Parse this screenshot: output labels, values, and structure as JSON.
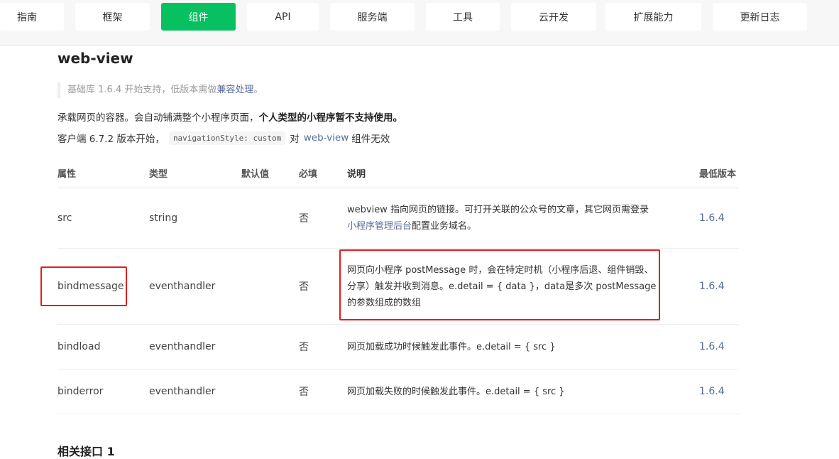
{
  "nav": {
    "items": [
      {
        "label": "指南"
      },
      {
        "label": "框架"
      },
      {
        "label": "组件"
      },
      {
        "label": "API"
      },
      {
        "label": "服务端"
      },
      {
        "label": "工具"
      },
      {
        "label": "云开发"
      },
      {
        "label": "扩展能力"
      },
      {
        "label": "更新日志"
      }
    ],
    "active_index": 2,
    "accent_color": "#07c160"
  },
  "page": {
    "title": "web-view",
    "tip_prefix": "基础库 1.6.4 开始支持，低版本需做",
    "tip_link": "兼容处理",
    "tip_suffix": "。",
    "desc1_normal": "承载网页的容器。会自动铺满整个小程序页面，",
    "desc1_bold": "个人类型的小程序暂不支持使用。",
    "desc2_prefix": "客户端 6.7.2 版本开始，",
    "desc2_code": "navigationStyle: custom",
    "desc2_mid": "对",
    "desc2_link": "web-view",
    "desc2_suffix": "组件无效",
    "footer_heading": "相关接口 1"
  },
  "table": {
    "headers": {
      "attr": "属性",
      "type": "类型",
      "default": "默认值",
      "required": "必填",
      "desc": "说明",
      "version": "最低版本"
    },
    "rows": [
      {
        "attr": "src",
        "type": "string",
        "default": "",
        "required": "否",
        "desc": "webview 指向网页的链接。可打开关联的公众号的文章，其它网页需登录",
        "desc_link": "小程序管理后台",
        "desc_suffix": "配置业务域名。",
        "version": "1.6.4"
      },
      {
        "attr": "bindmessage",
        "type": "eventhandler",
        "default": "",
        "required": "否",
        "desc": "网页向小程序 postMessage 时，会在特定时机（小程序后退、组件销毁、分享）触发并收到消息。e.detail = { data }，data是多次 postMessage 的参数组成的数组",
        "version": "1.6.4"
      },
      {
        "attr": "bindload",
        "type": "eventhandler",
        "default": "",
        "required": "否",
        "desc": "网页加载成功时候触发此事件。e.detail = { src }",
        "version": "1.6.4"
      },
      {
        "attr": "binderror",
        "type": "eventhandler",
        "default": "",
        "required": "否",
        "desc": "网页加载失败的时候触发此事件。e.detail = { src }",
        "version": "1.6.4"
      }
    ]
  },
  "annotation_color": "#e02020"
}
